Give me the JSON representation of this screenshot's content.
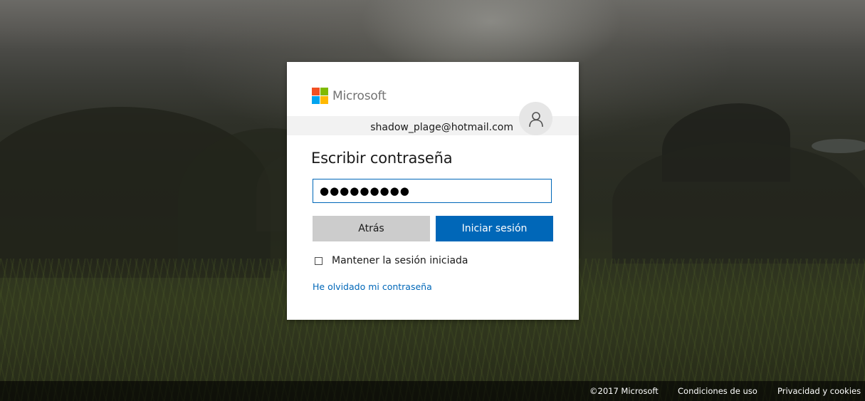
{
  "brand": {
    "name": "Microsoft",
    "logo_colors": [
      "#f25022",
      "#7fba00",
      "#00a4ef",
      "#ffb900"
    ]
  },
  "identity": {
    "email": "shadow_plage@hotmail.com",
    "avatar_icon": "user-icon"
  },
  "signin": {
    "title": "Escribir contraseña",
    "password_masked": "●●●●●●●●●",
    "back_button": "Atrás",
    "signin_button": "Iniciar sesión",
    "keep_signed_in": "Mantener la sesión iniciada",
    "keep_signed_in_checked": false,
    "forgot_password": "He olvidado mi contraseña"
  },
  "footer": {
    "copyright": "©2017 Microsoft",
    "terms": "Condiciones de uso",
    "privacy": "Privacidad y cookies"
  },
  "colors": {
    "accent": "#0067b8",
    "secondary_button": "#cccccc"
  }
}
